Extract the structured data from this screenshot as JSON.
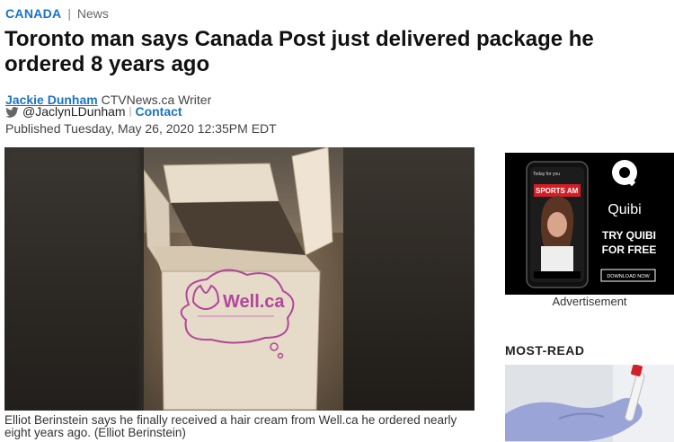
{
  "breadcrumb": {
    "section": "CANADA",
    "separator": "|",
    "subsection": "News"
  },
  "article": {
    "headline": "Toronto man says Canada Post just delivered package he ordered 8 years ago",
    "author": "Jackie Dunham",
    "author_role": "CTVNews.ca Writer",
    "twitter_handle": "@JaclynLDunham",
    "contact_label": "Contact",
    "published": "Published Tuesday, May 26, 2020 12:35PM EDT",
    "photo_box_brand": "Well.ca",
    "caption": "Elliot Berinstein says he finally received a hair cream from Well.ca he ordered nearly eight years ago. (Elliot Berinstein)"
  },
  "ad": {
    "brand": "Quibi",
    "cta": "TRY QUIBI FOR FREE",
    "button": "DOWNLOAD NOW",
    "phone_header": "Today for you",
    "phone_banner": "SPORTS AM",
    "label": "Advertisement"
  },
  "sidebar": {
    "most_read_title": "MOST-READ"
  },
  "colors": {
    "link": "#1a73c8",
    "ad_bg": "#000000",
    "box_logo": "#b0479a"
  },
  "icons": {
    "twitter": "twitter-icon"
  }
}
